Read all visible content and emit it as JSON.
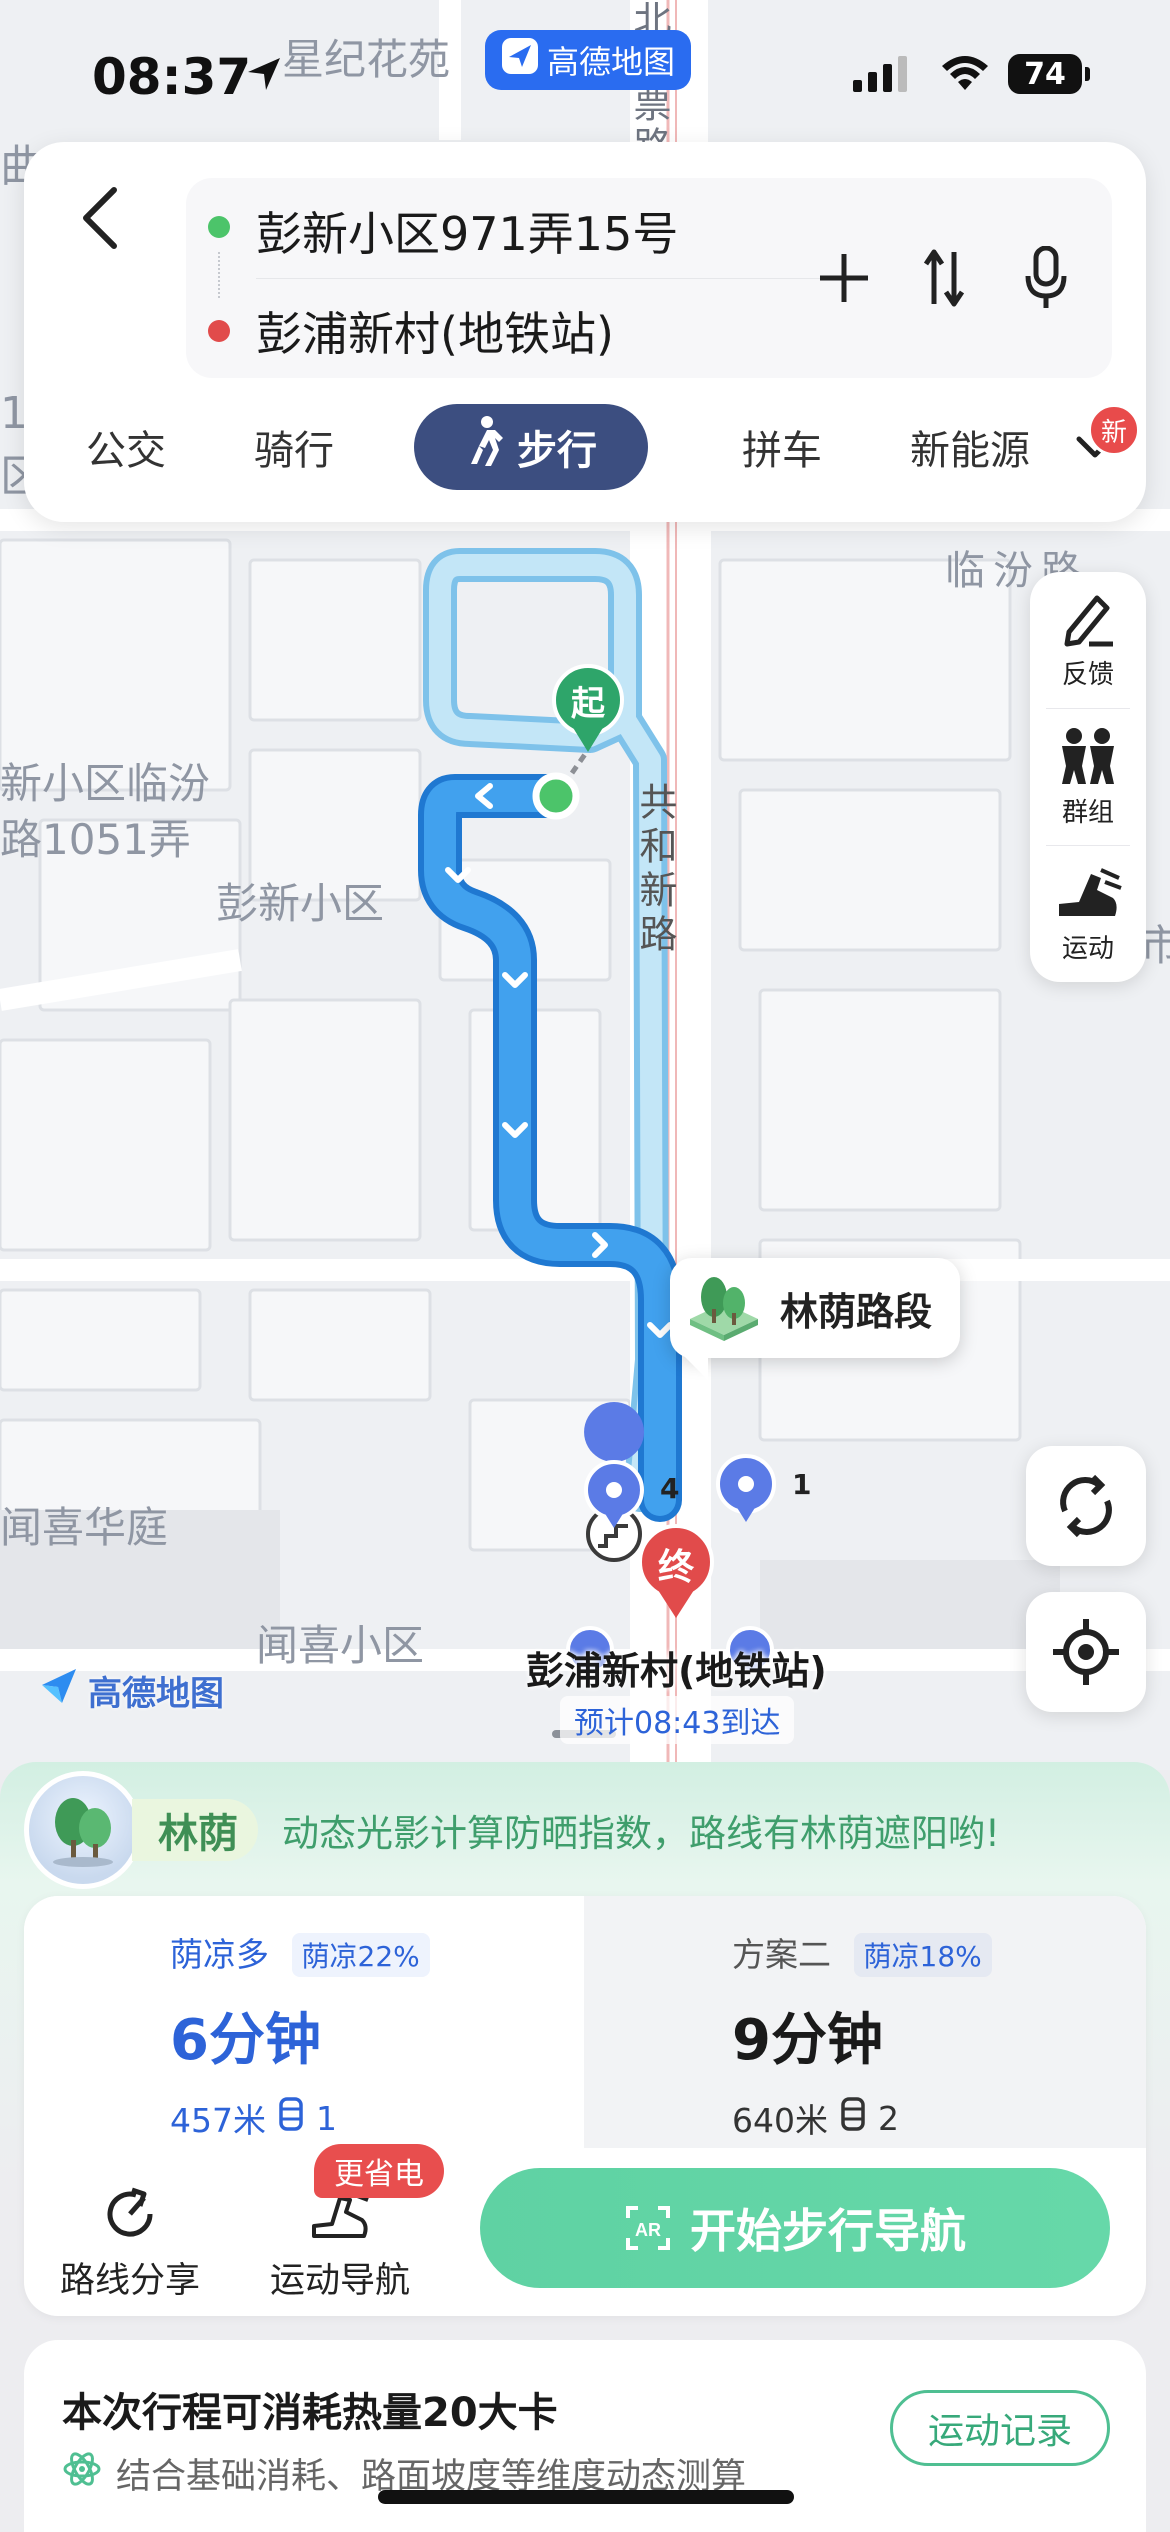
{
  "status_bar": {
    "time": "08:37",
    "battery": "74",
    "app_pill": "高德地图"
  },
  "route": {
    "origin": "彭新小区971弄15号",
    "destination": "彭浦新村(地铁站)",
    "origin_color": "#4cc46a",
    "destination_color": "#e14b4b"
  },
  "modes": {
    "items": [
      "公交",
      "骑行",
      "步行",
      "拼车",
      "新能源"
    ],
    "active": "步行",
    "new_badge": "新",
    "active_color": "#3c4e80"
  },
  "map": {
    "labels": {
      "top_estate": "星纪花苑",
      "top_road": "北",
      "top_road2": "票路",
      "left_edge": "曲",
      "left_edge2": "1",
      "left_edge3": "区",
      "linfen_road": "临汾路",
      "estate_linfen_1": "新小区临汾",
      "estate_linfen_2": "路1051弄",
      "pengxin": "彭新小区",
      "gonghexin_road": "共和新路",
      "wenxi_huating": "闻喜华庭",
      "wenxi_xiaoqu": "闻喜小区",
      "right_edge": "市"
    },
    "start_marker": "起",
    "end_marker": "终",
    "shade_poi": "林荫路段",
    "exit_4": "4",
    "exit_1": "1",
    "destination_name": "彭浦新村(地铁站)",
    "eta": "预计08:43到达",
    "logo": "高德地图",
    "route_color": "#3b9ae8",
    "alt_route_color": "#9fd3ef"
  },
  "tools": {
    "feedback": "反馈",
    "group": "群组",
    "sport": "运动"
  },
  "shade_banner": {
    "label": "林荫",
    "description": "动态光影计算防晒指数，路线有林荫遮阳哟!"
  },
  "plans": [
    {
      "tag": "荫凉多",
      "shade": "荫凉22%",
      "duration": "6分钟",
      "distance": "457米",
      "crossings": "1"
    },
    {
      "tag": "方案二",
      "shade": "荫凉18%",
      "duration": "9分钟",
      "distance": "640米",
      "crossings": "2"
    }
  ],
  "actions": {
    "share": "路线分享",
    "sport_nav": "运动导航",
    "saver_badge": "更省电",
    "start": "开始步行导航"
  },
  "calorie": {
    "title": "本次行程可消耗热量20大卡",
    "subtitle": "结合基础消耗、路面坡度等维度动态测算",
    "record": "运动记录"
  }
}
